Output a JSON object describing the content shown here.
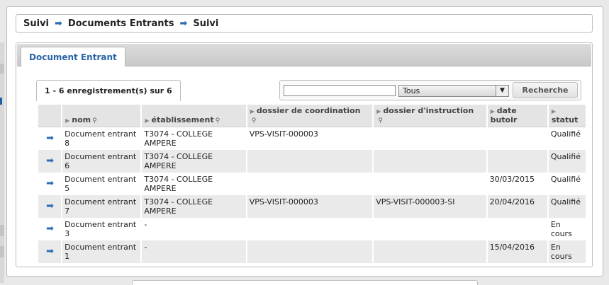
{
  "breadcrumb": {
    "items": [
      "Suivi",
      "Documents Entrants",
      "Suivi"
    ]
  },
  "tab": {
    "label": "Document Entrant"
  },
  "pagination": {
    "text": "1 - 6 enregistrement(s) sur 6"
  },
  "search": {
    "value": "",
    "select_value": "Tous",
    "button_label": "Recherche"
  },
  "table": {
    "headers": {
      "nom": "nom",
      "etablissement": "établissement",
      "dossier_coordination": "dossier de coordination",
      "dossier_instruction": "dossier d'instruction",
      "date_butoir": "date butoir",
      "statut": "statut"
    },
    "rows": [
      {
        "nom": "Document entrant 8",
        "etablissement": "T3074 - COLLEGE AMPERE",
        "dossier_coordination": "VPS-VISIT-000003",
        "dossier_instruction": "",
        "date_butoir": "",
        "statut": "Qualifié"
      },
      {
        "nom": "Document entrant 6",
        "etablissement": "T3074 - COLLEGE AMPERE",
        "dossier_coordination": "",
        "dossier_instruction": "",
        "date_butoir": "",
        "statut": "Qualifié"
      },
      {
        "nom": "Document entrant 5",
        "etablissement": "T3074 - COLLEGE AMPERE",
        "dossier_coordination": "",
        "dossier_instruction": "",
        "date_butoir": "30/03/2015",
        "statut": "Qualifié"
      },
      {
        "nom": "Document entrant 7",
        "etablissement": "T3074 - COLLEGE AMPERE",
        "dossier_coordination": "VPS-VISIT-000003",
        "dossier_instruction": "VPS-VISIT-000003-SI",
        "date_butoir": "20/04/2016",
        "statut": "Qualifié"
      },
      {
        "nom": "Document entrant 3",
        "etablissement": "-",
        "dossier_coordination": "",
        "dossier_instruction": "",
        "date_butoir": "",
        "statut": "En cours"
      },
      {
        "nom": "Document entrant 1",
        "etablissement": "-",
        "dossier_coordination": "",
        "dossier_instruction": "",
        "date_butoir": "15/04/2016",
        "statut": "En cours"
      }
    ]
  },
  "icons": {
    "breadcrumb_separator": "arrow-right-icon",
    "row_action": "arrow-right-icon",
    "sort": "sort-triangle-icon",
    "search": "magnifier-icon"
  },
  "colors": {
    "accent": "#2f6db3",
    "tab_text": "#2a64a8"
  }
}
